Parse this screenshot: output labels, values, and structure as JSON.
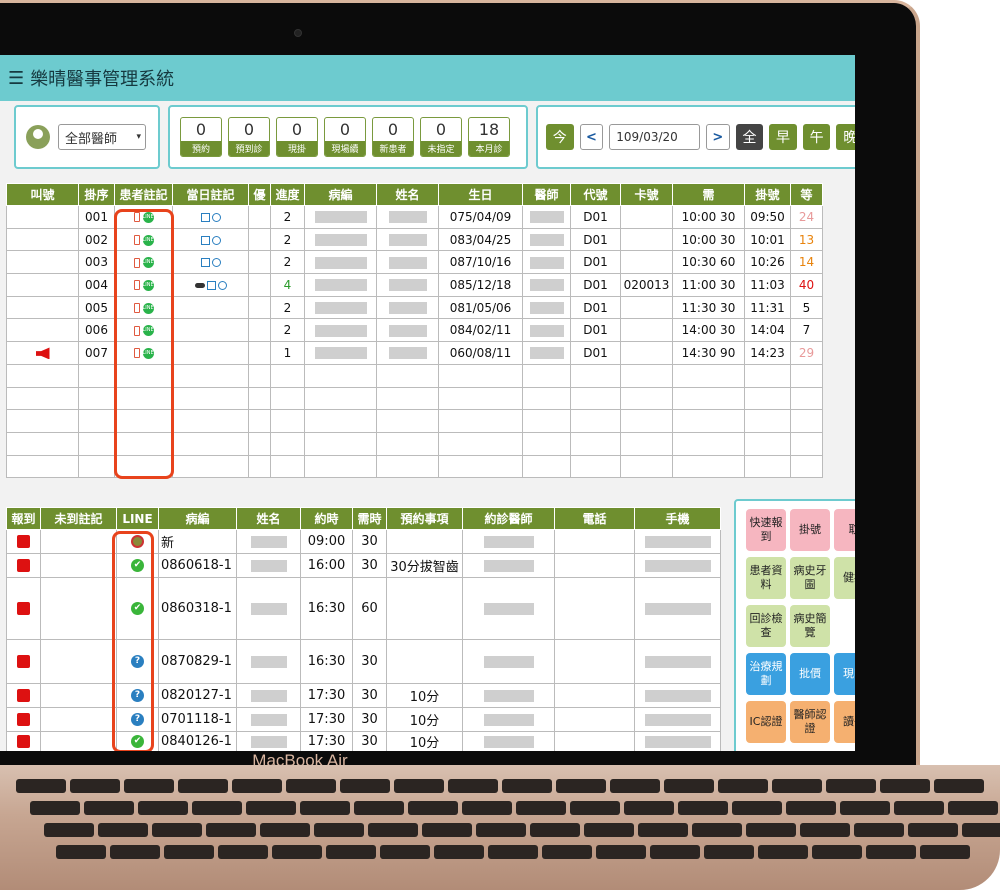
{
  "app": {
    "title": "樂晴醫事管理系統"
  },
  "doctor_select": {
    "value": "全部醫師"
  },
  "stats": [
    {
      "count": "0",
      "label": "預約"
    },
    {
      "count": "0",
      "label": "預到診"
    },
    {
      "count": "0",
      "label": "現掛"
    },
    {
      "count": "0",
      "label": "現場續"
    },
    {
      "count": "0",
      "label": "新患者"
    },
    {
      "count": "0",
      "label": "未指定"
    },
    {
      "count": "18",
      "label": "本月診"
    }
  ],
  "date_bar": {
    "today": "今",
    "prev": "<",
    "date": "109/03/20",
    "next": ">",
    "all": "全",
    "morning": "早",
    "noon": "午",
    "night": "晚"
  },
  "reg_table": {
    "headers": [
      "叫號",
      "掛序",
      "患者註記",
      "當日註記",
      "優",
      "進度",
      "病編",
      "姓名",
      "生日",
      "醫師",
      "代號",
      "卡號",
      "需",
      "掛號",
      "等"
    ],
    "rows": [
      {
        "seq": "001",
        "progress": "2",
        "birth": "075/04/09",
        "code": "D01",
        "card": "",
        "need": "10:00 30",
        "reg": "09:50",
        "wait": "24",
        "wait_color": "pink",
        "pill": false,
        "call": false
      },
      {
        "seq": "002",
        "progress": "2",
        "birth": "083/04/25",
        "code": "D01",
        "card": "",
        "need": "10:00 30",
        "reg": "10:01",
        "wait": "13",
        "wait_color": "orange",
        "pill": false,
        "call": false
      },
      {
        "seq": "003",
        "progress": "2",
        "birth": "087/10/16",
        "code": "D01",
        "card": "",
        "need": "10:30 60",
        "reg": "10:26",
        "wait": "14",
        "wait_color": "orange",
        "pill": false,
        "call": false
      },
      {
        "seq": "004",
        "progress": "4",
        "birth": "085/12/18",
        "code": "D01",
        "card": "020013",
        "need": "11:00 30",
        "reg": "11:03",
        "wait": "40",
        "wait_color": "red",
        "pill": true,
        "call": false
      },
      {
        "seq": "005",
        "progress": "2",
        "birth": "081/05/06",
        "code": "D01",
        "card": "",
        "need": "11:30 30",
        "reg": "11:31",
        "wait": "5",
        "wait_color": "",
        "pill": false,
        "call": false
      },
      {
        "seq": "006",
        "progress": "2",
        "birth": "084/02/11",
        "code": "D01",
        "card": "",
        "need": "14:00 30",
        "reg": "14:04",
        "wait": "7",
        "wait_color": "",
        "pill": false,
        "call": false
      },
      {
        "seq": "007",
        "progress": "1",
        "birth": "060/08/11",
        "code": "D01",
        "card": "",
        "need": "14:30 90",
        "reg": "14:23",
        "wait": "29",
        "wait_color": "pink",
        "pill": false,
        "call": true
      }
    ]
  },
  "appt_table": {
    "headers": [
      "報到",
      "未到註記",
      "LINE",
      "病編",
      "姓名",
      "約時",
      "需時",
      "預約事項",
      "約診醫師",
      "電話",
      "手機"
    ],
    "rows": [
      {
        "line": "none",
        "id": "新",
        "time": "09:00",
        "dur": "30",
        "note": ""
      },
      {
        "line": "check",
        "id": "0860618-1",
        "time": "16:00",
        "dur": "30",
        "note": "30分拔智齒"
      },
      {
        "line": "check",
        "id": "0860318-1",
        "time": "16:30",
        "dur": "60",
        "note": ""
      },
      {
        "line": "q",
        "id": "0870829-1",
        "time": "16:30",
        "dur": "30",
        "note": ""
      },
      {
        "line": "q",
        "id": "0820127-1",
        "time": "17:30",
        "dur": "30",
        "note": "10分"
      },
      {
        "line": "q",
        "id": "0701118-1",
        "time": "17:30",
        "dur": "30",
        "note": "10分"
      },
      {
        "line": "check",
        "id": "0840126-1",
        "time": "17:30",
        "dur": "30",
        "note": "10分"
      }
    ]
  },
  "side_buttons": [
    {
      "label": "快速報到",
      "style": "pink"
    },
    {
      "label": "掛號",
      "style": "pink"
    },
    {
      "label": "取",
      "style": "pink"
    },
    {
      "label": "患者資料",
      "style": "lg"
    },
    {
      "label": "病史牙圖",
      "style": "lg"
    },
    {
      "label": "健病",
      "style": "lg"
    },
    {
      "label": "回診檢查",
      "style": "lg"
    },
    {
      "label": "病史簡覽",
      "style": "lg"
    },
    {
      "label": "治療規劃",
      "style": "bl"
    },
    {
      "label": "批價",
      "style": "bl"
    },
    {
      "label": "現明",
      "style": "bl"
    },
    {
      "label": "IC認證",
      "style": "or"
    },
    {
      "label": "醫師認證",
      "style": "or"
    },
    {
      "label": "讀醫",
      "style": "or"
    }
  ],
  "device": {
    "label": "MacBook Air"
  }
}
